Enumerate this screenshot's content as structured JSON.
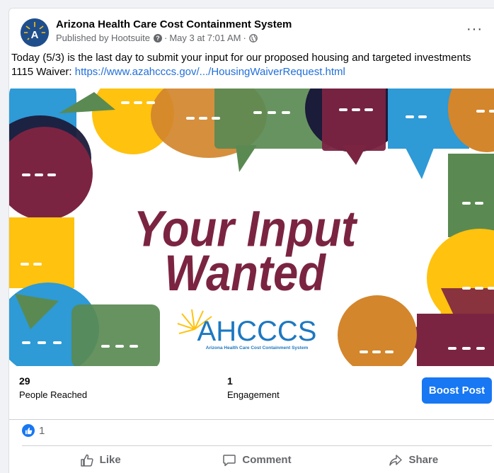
{
  "post": {
    "page_name": "Arizona Health Care Cost Containment System",
    "published_by": "Published by Hootsuite",
    "help_glyph": "?",
    "date": "May 3 at 7:01 AM",
    "separator": "·",
    "more_glyph": "···",
    "text": "Today (5/3) is the last day to submit your input for our proposed housing and targeted investments 1115 Waiver: ",
    "link": "https://www.azahcccs.gov/.../HousingWaiverRequest.html",
    "avatar_letter": "A"
  },
  "image": {
    "headline_line1": "Your Input",
    "headline_line2": "Wanted",
    "logo_text": "AHCCCS",
    "logo_subtitle": "Arizona Health Care Cost Containment System",
    "colors": {
      "maroon": "#7b2442",
      "yellow": "#ffc20e",
      "orange": "#d3862c",
      "green": "#5a8a52",
      "blue": "#2e9ad6",
      "navy": "#1b1b3a",
      "logo_blue": "#1d78c1"
    }
  },
  "stats": {
    "reached_value": "29",
    "reached_label": "People Reached",
    "engagement_value": "1",
    "engagement_label": "Engagement",
    "boost_label": "Boost Post"
  },
  "reactions": {
    "count": "1",
    "icon": "thumbs-up-icon"
  },
  "actions": {
    "like": "Like",
    "comment": "Comment",
    "share": "Share"
  }
}
